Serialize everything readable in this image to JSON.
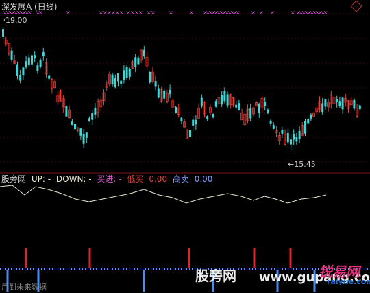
{
  "header": {
    "title": "深发展A (日线)",
    "price_high_label": "19.00",
    "price_low_label": "15.45"
  },
  "indicator": {
    "name": "股旁网",
    "up_label": "UP: -",
    "down_label": "DOWN: -",
    "buy_label": "买进: -",
    "low_buy_label": "低买",
    "low_buy_value": "0.00",
    "high_sell_label": "高卖",
    "high_sell_value": "0.00"
  },
  "footer": {
    "left_text": "用到未来数据"
  },
  "watermark": {
    "site_cn": "股旁网",
    "site_url": "www.gupang.com",
    "logo_text": "锐易网",
    "logo_url": "raiyue.com"
  },
  "colors": {
    "up": "#e0413b",
    "down": "#3fd6d6",
    "signal_red": "#e0242a",
    "signal_blue": "#4a8cf0",
    "marker": "#d65ad6",
    "line": "#e8e8cf",
    "dotted": "#5aa0ff"
  },
  "icons": {
    "corner": "diamond-icon"
  }
}
